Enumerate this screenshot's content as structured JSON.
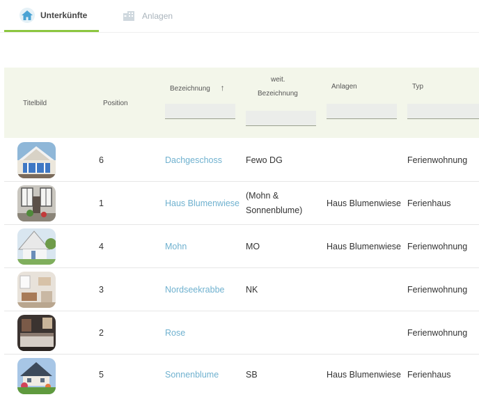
{
  "tabs": [
    {
      "label": "Unterkünfte",
      "icon": "home-icon",
      "active": true
    },
    {
      "label": "Anlagen",
      "icon": "building-icon",
      "active": false
    }
  ],
  "table": {
    "columns": {
      "titelbild": "Titelbild",
      "position": "Position",
      "bezeichnung": "Bezeichnung",
      "sort_icon": "↑",
      "weit_line1": "weit.",
      "weit_line2": "Bezeichnung",
      "anlagen": "Anlagen",
      "typ": "Typ"
    },
    "filters": {
      "bezeichnung": "",
      "weit": "",
      "anlagen": "",
      "typ": ""
    },
    "rows": [
      {
        "position": "6",
        "bezeichnung": "Dachgeschoss",
        "weit1": "Fewo DG",
        "weit2": "",
        "anlage": "",
        "typ": "Ferienwohnung",
        "image": "house-gable-photo"
      },
      {
        "position": "1",
        "bezeichnung": "Haus Blumenwiese",
        "weit1": "(Mohn &",
        "weit2": "Sonnenblume)",
        "anlage": "Haus Blumenwiese",
        "typ": "Ferienhaus",
        "image": "house-windows-photo"
      },
      {
        "position": "4",
        "bezeichnung": "Mohn",
        "weit1": "MO",
        "weit2": "",
        "anlage": "Haus Blumenwiese",
        "typ": "Ferienwohnung",
        "image": "house-garden-photo"
      },
      {
        "position": "3",
        "bezeichnung": "Nordseekrabbe",
        "weit1": "NK",
        "weit2": "",
        "anlage": "",
        "typ": "Ferienwohnung",
        "image": "interior-photo"
      },
      {
        "position": "2",
        "bezeichnung": "Rose",
        "weit1": "",
        "weit2": "",
        "anlage": "",
        "typ": "Ferienwohnung",
        "image": "bedroom-photo"
      },
      {
        "position": "5",
        "bezeichnung": "Sonnenblume",
        "weit1": "SB",
        "weit2": "",
        "anlage": "Haus Blumenwiese",
        "typ": "Ferienhaus",
        "image": "house-lawn-photo"
      }
    ]
  },
  "colors": {
    "accent": "#8cc63f",
    "link": "#6fb1cf",
    "header_bg": "#f3f6ea"
  }
}
